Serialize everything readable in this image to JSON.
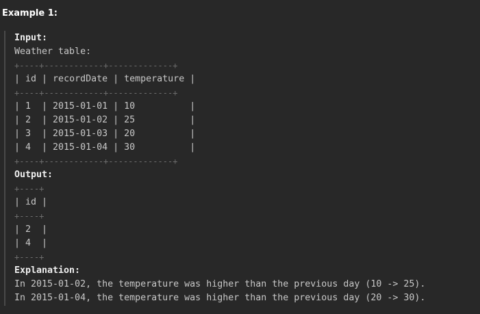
{
  "example": {
    "title": "Example 1:"
  },
  "input": {
    "label": "Input:",
    "table_caption": "Weather table:",
    "border": "+----+------------+-------------+",
    "header": {
      "id": "| id |",
      "recordDate": " recordDate ",
      "temperature": "| temperature |",
      "sep": "|"
    },
    "rows": [
      {
        "id": "| 1  ",
        "date": "| 2015-01-01 ",
        "temp": "| 10          ",
        "end": "|"
      },
      {
        "id": "| 2  ",
        "date": "| 2015-01-02 ",
        "temp": "| 25          ",
        "end": "|"
      },
      {
        "id": "| 3  ",
        "date": "| 2015-01-03 ",
        "temp": "| 20          ",
        "end": "|"
      },
      {
        "id": "| 4  ",
        "date": "| 2015-01-04 ",
        "temp": "| 30          ",
        "end": "|"
      }
    ]
  },
  "output": {
    "label": "Output:",
    "border": "+----+",
    "header": "| id |",
    "rows": [
      "| 2  |",
      "| 4  |"
    ]
  },
  "explanation": {
    "label": "Explanation:",
    "lines": [
      "In 2015-01-02, the temperature was higher than the previous day (10 -> 25).",
      "In 2015-01-04, the temperature was higher than the previous day (20 -> 30)."
    ]
  }
}
